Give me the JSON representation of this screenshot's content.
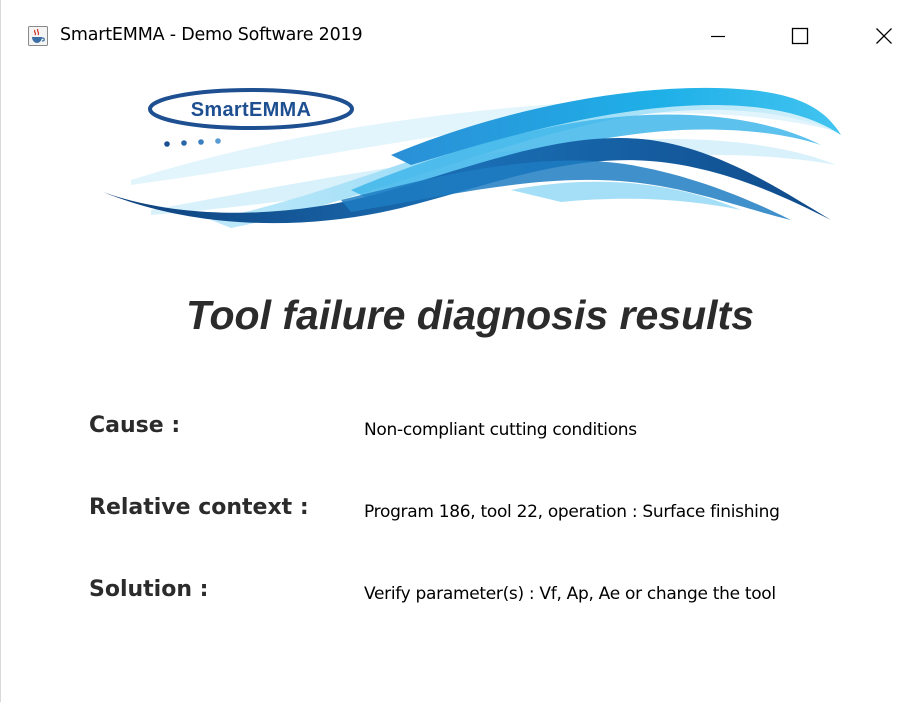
{
  "window": {
    "title": "SmartEMMA - Demo Software 2019",
    "icon": "java-cup-icon",
    "controls": {
      "minimize_icon": "minimize-icon",
      "maximize_icon": "maximize-icon",
      "close_icon": "close-icon"
    }
  },
  "banner": {
    "logo_text": "SmartEMMA",
    "colors": {
      "dark_blue": "#1d4f91",
      "mid_blue": "#1a8fd0",
      "light_blue": "#7fd3f3"
    }
  },
  "heading": "Tool failure diagnosis results",
  "results": [
    {
      "label": "Cause :",
      "value": "Non-compliant cutting conditions"
    },
    {
      "label": "Relative context :",
      "value": "Program 186, tool 22, operation : Surface finishing"
    },
    {
      "label": "Solution :",
      "value": "Verify parameter(s) : Vf, Ap, Ae or change the tool"
    }
  ]
}
